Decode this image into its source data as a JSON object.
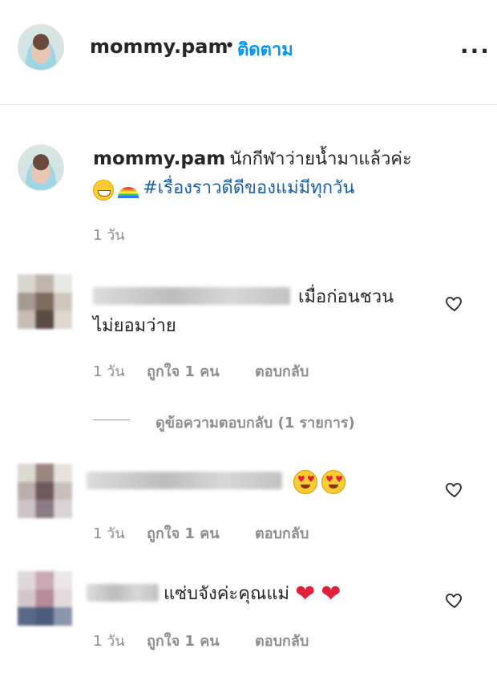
{
  "header": {
    "username": "mommy.pam",
    "separator": "•",
    "follow_label": "ติดตาม",
    "more_label": "..."
  },
  "caption": {
    "username": "mommy.pam",
    "text": "นักกีฬาว่ายน้ำมาแล้วค่ะ",
    "hashtag": "#เรื่องราวดีดีของแม่มีทุกวัน",
    "time": "1 วัน",
    "emoji": [
      "grinning-face",
      "rainbow"
    ]
  },
  "comments": [
    {
      "text_line1": "เมื่อก่อนชวน",
      "text_line2": "ไม่ยอมว่าย",
      "time": "1 วัน",
      "likes": "ถูกใจ 1 คน",
      "reply_label": "ตอบกลับ",
      "view_replies": "ดูข้อความตอบกลับ (1 รายการ)"
    },
    {
      "text": "",
      "emoji": [
        "heart-eyes",
        "heart-eyes"
      ],
      "time": "1 วัน",
      "likes": "ถูกใจ 1 คน",
      "reply_label": "ตอบกลับ"
    },
    {
      "text": "แซ่บจังค่ะคุณแม่",
      "emoji": [
        "red-heart",
        "red-heart"
      ],
      "time": "1 วัน",
      "likes": "ถูกใจ 1 คน",
      "reply_label": "ตอบกลับ"
    }
  ],
  "colors": {
    "follow": "#0095f6",
    "hashtag": "#1b5fa8",
    "muted": "#8e8e8e",
    "text": "#262626",
    "heart": "#e0213a"
  }
}
